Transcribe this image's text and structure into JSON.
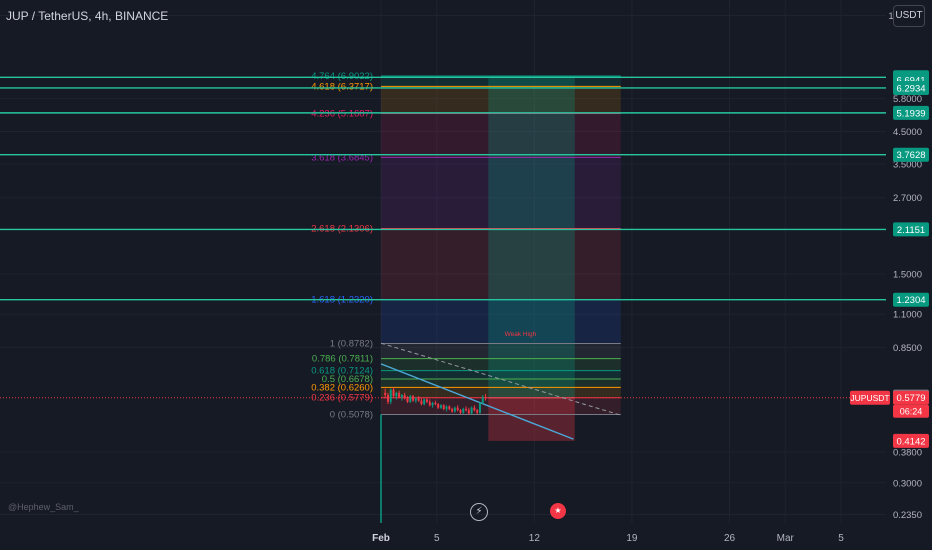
{
  "header": {
    "title": "JUP / TetherUS, 4h, BINANCE"
  },
  "toolbar": {
    "currency": "USDT"
  },
  "watermark": "@Hephew_Sam_",
  "chart_data": {
    "type": "line",
    "y_scale": "log",
    "ylim": [
      0.22,
      12.4
    ],
    "x_ticks": [
      {
        "day": 0,
        "label": "Feb"
      },
      {
        "day": 4,
        "label": "5"
      },
      {
        "day": 11,
        "label": "12"
      },
      {
        "day": 18,
        "label": "19"
      },
      {
        "day": 25,
        "label": "26"
      },
      {
        "day": 29,
        "label": "Mar"
      },
      {
        "day": 33,
        "label": "5"
      }
    ],
    "y_ticks": [
      "0.2350",
      "0.3000",
      "0.3800",
      "0.8500",
      "1.1000",
      "1.5000",
      "2.7000",
      "3.5000",
      "4.5000",
      "5.8000",
      "11.0000"
    ],
    "price_labels": [
      {
        "value": 6.8332,
        "text": "6.8332",
        "color": "#089981"
      },
      {
        "value": 6.6941,
        "text": "6.6941",
        "color": "#089981"
      },
      {
        "value": 6.2934,
        "text": "6.2934",
        "color": "#089981"
      },
      {
        "value": 5.1939,
        "text": "5.1939",
        "color": "#089981"
      },
      {
        "value": 3.7628,
        "text": "3.7628",
        "color": "#089981"
      },
      {
        "value": 2.1151,
        "text": "2.1151",
        "color": "#089981"
      },
      {
        "value": 1.2304,
        "text": "1.2304",
        "color": "#089981"
      },
      {
        "value": 0.5826,
        "text": "0.5826",
        "color": "#787b86"
      },
      {
        "value": 0.5779,
        "text": "0.5779",
        "color": "#f23645"
      },
      {
        "value": 0.4142,
        "text": "0.4142",
        "color": "#f23645"
      }
    ],
    "current_price": {
      "symbol": "JUPUSDT",
      "value": 0.5779,
      "countdown": "06:24"
    },
    "horizontal_lines": [
      6.8332,
      6.2934,
      5.1939,
      3.7628,
      2.1151,
      1.2304
    ],
    "fib_levels": [
      {
        "ratio": 0,
        "value": 0.5078,
        "label": "0 (0.5078)",
        "color": "#787b86"
      },
      {
        "ratio": 0.236,
        "value": 0.5779,
        "label": "0.236 (0.5779)",
        "color": "#f23645"
      },
      {
        "ratio": 0.382,
        "value": 0.626,
        "label": "0.382 (0.6260)",
        "color": "#ff9800"
      },
      {
        "ratio": 0.5,
        "value": 0.6678,
        "label": "0.5 (0.6678)",
        "color": "#4caf50"
      },
      {
        "ratio": 0.618,
        "value": 0.7124,
        "label": "0.618 (0.7124)",
        "color": "#089981"
      },
      {
        "ratio": 0.786,
        "value": 0.7811,
        "label": "0.786 (0.7811)",
        "color": "#4caf50"
      },
      {
        "ratio": 1,
        "value": 0.8782,
        "label": "1 (0.8782)",
        "color": "#787b86"
      },
      {
        "ratio": 1.618,
        "value": 1.232,
        "label": "1.618 (1.2320)",
        "color": "#2962ff"
      },
      {
        "ratio": 2.618,
        "value": 2.1306,
        "label": "2.618 (2.1306)",
        "color": "#f23645"
      },
      {
        "ratio": 3.618,
        "value": 3.6845,
        "label": "3.618 (3.6845)",
        "color": "#9c27b0"
      },
      {
        "ratio": 4.236,
        "value": 5.1687,
        "label": "4.236 (5.1687)",
        "color": "#e91e63"
      },
      {
        "ratio": 4.618,
        "value": 6.3717,
        "label": "4.618 (6.3717)",
        "color": "#ff9800"
      },
      {
        "ratio": 4.764,
        "value": 6.9022,
        "label": "4.764 (6.9022)",
        "color": "#089981"
      }
    ],
    "fib_start_day": 0,
    "fib_end_day": 17.2,
    "long_position": {
      "start_day": 7.7,
      "end_day": 13.9,
      "entry": 0.5779,
      "target": 6.9022,
      "stop": 0.4142
    },
    "trendlines": [
      {
        "from": [
          0,
          0.75
        ],
        "to": [
          13.8,
          0.42
        ]
      },
      {
        "from": [
          0,
          0.88
        ],
        "to": [
          17.2,
          0.505
        ]
      }
    ],
    "annotations": [
      {
        "text": "Weak High",
        "day": 10,
        "value": 0.93
      }
    ],
    "candles": [
      {
        "day": 0.3,
        "o": 0.6,
        "h": 0.62,
        "l": 0.575,
        "c": 0.59
      },
      {
        "day": 0.5,
        "o": 0.59,
        "h": 0.6,
        "l": 0.55,
        "c": 0.56
      },
      {
        "day": 0.7,
        "o": 0.56,
        "h": 0.62,
        "l": 0.55,
        "c": 0.615
      },
      {
        "day": 0.9,
        "o": 0.615,
        "h": 0.625,
        "l": 0.58,
        "c": 0.585
      },
      {
        "day": 1.1,
        "o": 0.585,
        "h": 0.605,
        "l": 0.57,
        "c": 0.6
      },
      {
        "day": 1.3,
        "o": 0.6,
        "h": 0.61,
        "l": 0.575,
        "c": 0.58
      },
      {
        "day": 1.5,
        "o": 0.58,
        "h": 0.595,
        "l": 0.565,
        "c": 0.59
      },
      {
        "day": 1.7,
        "o": 0.59,
        "h": 0.6,
        "l": 0.57,
        "c": 0.575
      },
      {
        "day": 1.9,
        "o": 0.575,
        "h": 0.585,
        "l": 0.555,
        "c": 0.56
      },
      {
        "day": 2.1,
        "o": 0.56,
        "h": 0.59,
        "l": 0.555,
        "c": 0.585
      },
      {
        "day": 2.3,
        "o": 0.585,
        "h": 0.59,
        "l": 0.56,
        "c": 0.565
      },
      {
        "day": 2.5,
        "o": 0.565,
        "h": 0.58,
        "l": 0.555,
        "c": 0.575
      },
      {
        "day": 2.7,
        "o": 0.575,
        "h": 0.585,
        "l": 0.56,
        "c": 0.565
      },
      {
        "day": 2.9,
        "o": 0.565,
        "h": 0.575,
        "l": 0.545,
        "c": 0.55
      },
      {
        "day": 3.1,
        "o": 0.55,
        "h": 0.575,
        "l": 0.545,
        "c": 0.57
      },
      {
        "day": 3.3,
        "o": 0.57,
        "h": 0.58,
        "l": 0.555,
        "c": 0.56
      },
      {
        "day": 3.5,
        "o": 0.56,
        "h": 0.57,
        "l": 0.54,
        "c": 0.545
      },
      {
        "day": 3.7,
        "o": 0.545,
        "h": 0.56,
        "l": 0.535,
        "c": 0.555
      },
      {
        "day": 3.9,
        "o": 0.555,
        "h": 0.565,
        "l": 0.545,
        "c": 0.55
      },
      {
        "day": 4.1,
        "o": 0.55,
        "h": 0.555,
        "l": 0.53,
        "c": 0.535
      },
      {
        "day": 4.3,
        "o": 0.535,
        "h": 0.55,
        "l": 0.53,
        "c": 0.545
      },
      {
        "day": 4.5,
        "o": 0.545,
        "h": 0.55,
        "l": 0.525,
        "c": 0.53
      },
      {
        "day": 4.7,
        "o": 0.53,
        "h": 0.545,
        "l": 0.52,
        "c": 0.54
      },
      {
        "day": 4.9,
        "o": 0.54,
        "h": 0.545,
        "l": 0.525,
        "c": 0.53
      },
      {
        "day": 5.1,
        "o": 0.53,
        "h": 0.535,
        "l": 0.515,
        "c": 0.52
      },
      {
        "day": 5.3,
        "o": 0.52,
        "h": 0.54,
        "l": 0.515,
        "c": 0.535
      },
      {
        "day": 5.5,
        "o": 0.535,
        "h": 0.545,
        "l": 0.52,
        "c": 0.525
      },
      {
        "day": 5.7,
        "o": 0.525,
        "h": 0.53,
        "l": 0.51,
        "c": 0.515
      },
      {
        "day": 5.9,
        "o": 0.515,
        "h": 0.535,
        "l": 0.51,
        "c": 0.53
      },
      {
        "day": 6.1,
        "o": 0.53,
        "h": 0.54,
        "l": 0.52,
        "c": 0.525
      },
      {
        "day": 6.3,
        "o": 0.525,
        "h": 0.535,
        "l": 0.508,
        "c": 0.512
      },
      {
        "day": 6.5,
        "o": 0.512,
        "h": 0.54,
        "l": 0.508,
        "c": 0.535
      },
      {
        "day": 6.7,
        "o": 0.535,
        "h": 0.545,
        "l": 0.52,
        "c": 0.525
      },
      {
        "day": 6.9,
        "o": 0.525,
        "h": 0.53,
        "l": 0.51,
        "c": 0.515
      },
      {
        "day": 7.1,
        "o": 0.515,
        "h": 0.56,
        "l": 0.51,
        "c": 0.555
      },
      {
        "day": 7.3,
        "o": 0.555,
        "h": 0.59,
        "l": 0.55,
        "c": 0.58
      },
      {
        "day": 7.5,
        "o": 0.58,
        "h": 0.595,
        "l": 0.565,
        "c": 0.5779
      }
    ]
  }
}
